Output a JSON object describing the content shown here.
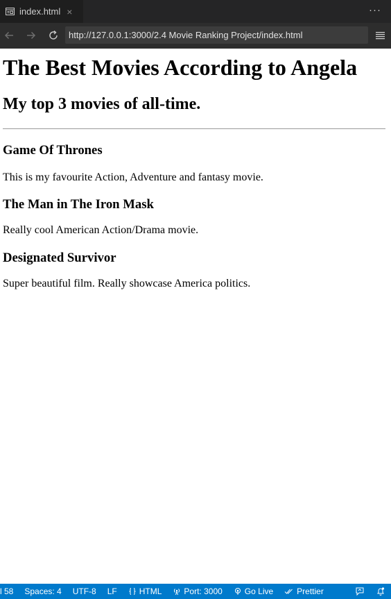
{
  "tab": {
    "label": "index.html",
    "close": "×",
    "icon": "browser-preview-icon"
  },
  "tabbar": {
    "more": "···"
  },
  "navbar": {
    "url": "http://127.0.0.1:3000/2.4 Movie Ranking Project/index.html",
    "back_icon": "arrow-left-icon",
    "forward_icon": "arrow-right-icon",
    "reload_icon": "reload-icon",
    "menu_icon": "hamburger-menu-icon"
  },
  "page": {
    "title": "The Best Movies According to Angela",
    "subtitle": "My top 3 movies of all-time.",
    "movies": [
      {
        "title": "Game Of Thrones",
        "description": "This is my favourite Action, Adventure and fantasy movie."
      },
      {
        "title": "The Man in The Iron Mask",
        "description": "Really cool American Action/Drama movie."
      },
      {
        "title": "Designated Survivor",
        "description": "Super beautiful film. Really showcase America politics."
      }
    ]
  },
  "statusbar": {
    "position": "l 58",
    "spaces": "Spaces: 4",
    "encoding": "UTF-8",
    "eol": "LF",
    "language": "HTML",
    "port": "Port: 3000",
    "go_live": "Go Live",
    "prettier": "Prettier"
  },
  "colors": {
    "statusbar": "#007acc",
    "tabbar": "#252526",
    "navbar": "#2d2d2d",
    "url_field": "#3c3c3c"
  }
}
